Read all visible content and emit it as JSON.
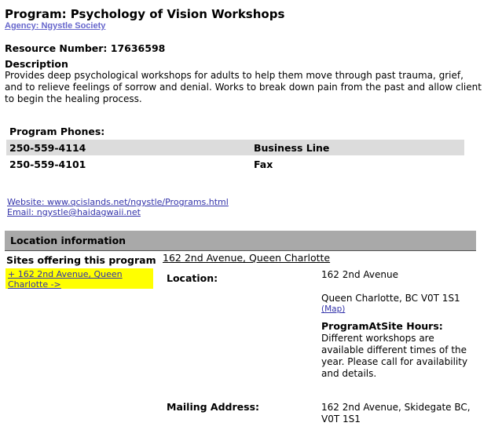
{
  "program": {
    "title": "Program: Psychology of Vision Workshops",
    "agency_link": "Agency: Ngystle Society",
    "resource_number": "Resource Number: 17636598",
    "description_heading": "Description",
    "description": "Provides deep psychological workshops for adults to help them move through past trauma, grief, and to relieve feelings of sorrow and denial. Works to break down pain from the past and allow client to begin the healing process."
  },
  "phones": {
    "heading": "Program Phones:",
    "rows": [
      {
        "number": "250-559-4114",
        "label": "Business Line"
      },
      {
        "number": "250-559-4101",
        "label": "Fax"
      }
    ]
  },
  "contact": {
    "website": "Website: www.qcislands.net/ngystle/Programs.html",
    "email": "Email: ngystle@haidagwaii.net"
  },
  "location": {
    "bar_title": "Location information",
    "sites_heading": "Sites offering this program",
    "site_link": "+ 162 2nd Avenue, Queen Charlotte ->",
    "site_title_link": "162 2nd Avenue, Queen Charlotte",
    "location_label": "Location:",
    "address_line1": "162 2nd Avenue",
    "address_line2": "Queen Charlotte, BC V0T 1S1",
    "map_link": "(Map)",
    "hours_heading": "ProgramAtSite Hours:",
    "hours_text": "Different workshops are available different times of the year. Please call for availability and details.",
    "mailing_label": "Mailing Address:",
    "mailing_value": "162 2nd Avenue, Skidegate BC, V0T 1S1"
  }
}
